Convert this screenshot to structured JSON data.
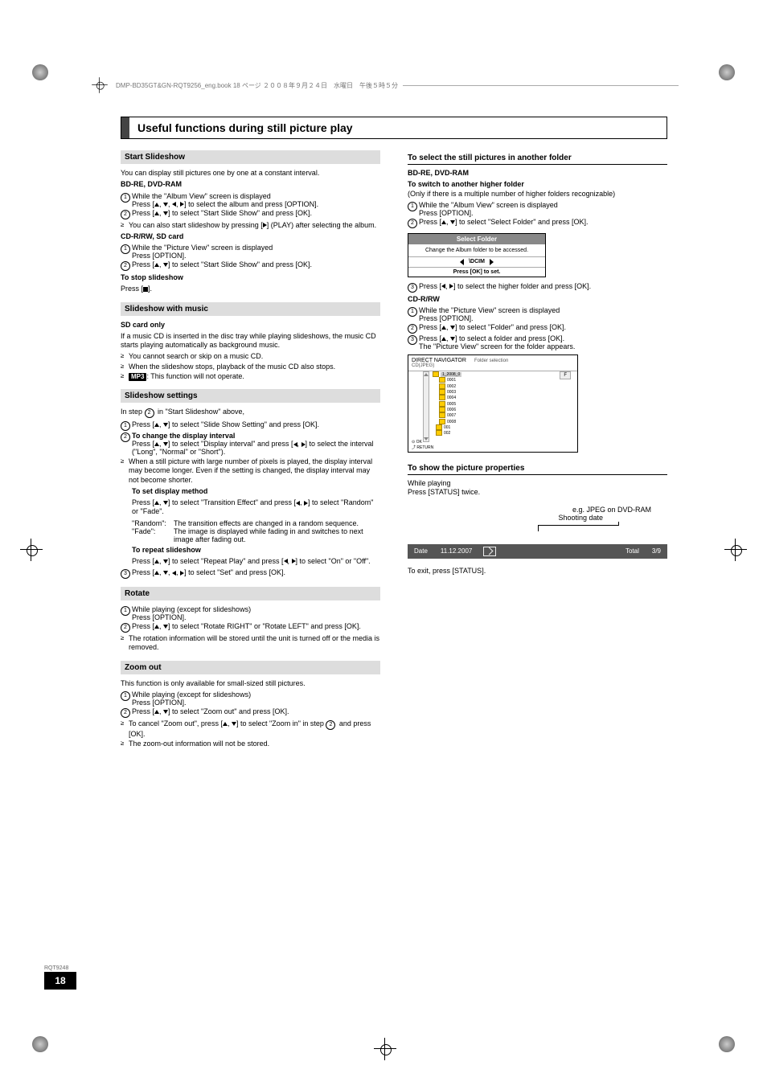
{
  "header_note": "DMP-BD35GT&GN-RQT9256_eng.book  18 ページ  ２００８年９月２４日　水曜日　午後５時５分",
  "title": "Useful functions during still picture play",
  "left": {
    "s1": {
      "head": "Start Slideshow",
      "intro": "You can display still pictures one by one at a constant interval.",
      "bdre_head": "BD-RE, DVD-RAM",
      "step1": "While the \"Album View\" screen is displayed\nPress [▲, ▼, ◀, ▶] to select the album and press [OPTION].",
      "step2": "Press [▲, ▼] to select \"Start Slide Show\" and press [OK].",
      "bullet1": "You can also start slideshow by pressing [▶] (PLAY) after selecting the album.",
      "cdr_head": "CD-R/RW, SD card",
      "cdr_step1": "While the \"Picture View\" screen is displayed\nPress [OPTION].",
      "cdr_step2": "Press [▲, ▼] to select \"Start Slide Show\" and press [OK].",
      "stop_head": "To stop slideshow",
      "stop_body": "Press [∎]."
    },
    "s2": {
      "head": "Slideshow with music",
      "sub": "SD card only",
      "intro": "If a music CD is inserted in the disc tray while playing slideshows, the music CD starts playing automatically as background music.",
      "b1": "You cannot search or skip on a music CD.",
      "b2": "When the slideshow stops, playback of the music CD also stops.",
      "b3_pre": "",
      "b3_tag": "MP3",
      "b3_post": ": This function will not operate."
    },
    "s3": {
      "head": "Slideshow settings",
      "intro": "In step ② in \"Start Slideshow\" above,",
      "step1": "Press [▲, ▼] to select \"Slide Show Setting\" and press [OK].",
      "step2_head": "To change the display interval",
      "step2_body": "Press [▲, ▼] to select \"Display interval\" and press [◀, ▶] to select the interval (\"Long\", \"Normal\" or \"Short\").",
      "step2_bullet": "When a still picture with large number of pixels is played, the display interval may become longer. Even if the setting is changed, the display interval may not become shorter.",
      "disp_head": "To set display method",
      "disp_body": "Press [▲, ▼] to select \"Transition Effect\" and press [◀, ▶] to select \"Random\" or \"Fade\".",
      "random_label": "\"Random\":",
      "random_desc": "The transition effects are changed in a random sequence.",
      "fade_label": "\"Fade\":",
      "fade_desc": "The image is displayed while fading in and switches to next image after fading out.",
      "repeat_head": "To repeat slideshow",
      "repeat_body": "Press [▲, ▼] to select \"Repeat Play\" and press [◀, ▶] to select \"On\" or \"Off\".",
      "step3": "Press [▲, ▼, ◀, ▶] to select \"Set\" and press [OK]."
    },
    "s4": {
      "head": "Rotate",
      "step1": "While playing (except for slideshows)\nPress [OPTION].",
      "step2": "Press [▲, ▼] to select \"Rotate RIGHT\" or \"Rotate LEFT\" and press [OK].",
      "bullet": "The rotation information will be stored until the unit is turned off or the media is removed."
    },
    "s5": {
      "head": "Zoom out",
      "intro": "This function is only available for small-sized still pictures.",
      "step1": "While playing (except for slideshows)\nPress [OPTION].",
      "step2": "Press [▲, ▼] to select \"Zoom out\" and press [OK].",
      "b1": "To cancel \"Zoom out\", press [▲, ▼] to select \"Zoom in\" in step ② and press [OK].",
      "b2": "The zoom-out information will not be stored."
    }
  },
  "right": {
    "r1": {
      "head": "To select the still pictures in another folder",
      "bdre_head": "BD-RE, DVD-RAM",
      "switch_head": "To switch to another higher folder",
      "switch_note": "(Only if there is a multiple number of higher folders recognizable)",
      "step1": "While the \"Album View\" screen is displayed\nPress [OPTION].",
      "step2": "Press [▲, ▼] to select \"Select Folder\" and press [OK].",
      "sf_title": "Select Folder",
      "sf_text": "Change the Album folder to be accessed.",
      "sf_folder": "\\DCIM",
      "sf_ok": "Press [OK] to set.",
      "step3": "Press [◀, ▶] to select the higher folder and press [OK].",
      "cdr_head": "CD-R/RW",
      "cdr_s1": "While the \"Picture View\" screen is displayed\nPress [OPTION].",
      "cdr_s2": "Press [▲, ▼] to select \"Folder\" and press [OK].",
      "cdr_s3": "Press [▲, ▼] to select a folder and press [OK].\nThe \"Picture View\" screen for the folder appears.",
      "dn_title": "DIRECT NAVIGATOR",
      "dn_sub": "Folder selection",
      "dn_media": "CD(JPEG)",
      "dn_btn": "F",
      "dn_folders": [
        "1_2008_0",
        "0001",
        "0002",
        "0003",
        "0004",
        "0005",
        "0006",
        "0007",
        "0008",
        "001",
        "002"
      ],
      "dn_footer": "OK\nRETURN"
    },
    "r2": {
      "head": "To show the picture properties",
      "intro1": "While playing",
      "intro2": "Press [STATUS] twice.",
      "eg": "e.g. JPEG on DVD-RAM",
      "shooting": "Shooting date",
      "date_k": "Date",
      "date_v": "11.12.2007",
      "total_k": "Total",
      "total_v": "3/9",
      "exit": "To exit, press [STATUS]."
    }
  },
  "footer": {
    "code": "RQT9248",
    "page": "18"
  }
}
